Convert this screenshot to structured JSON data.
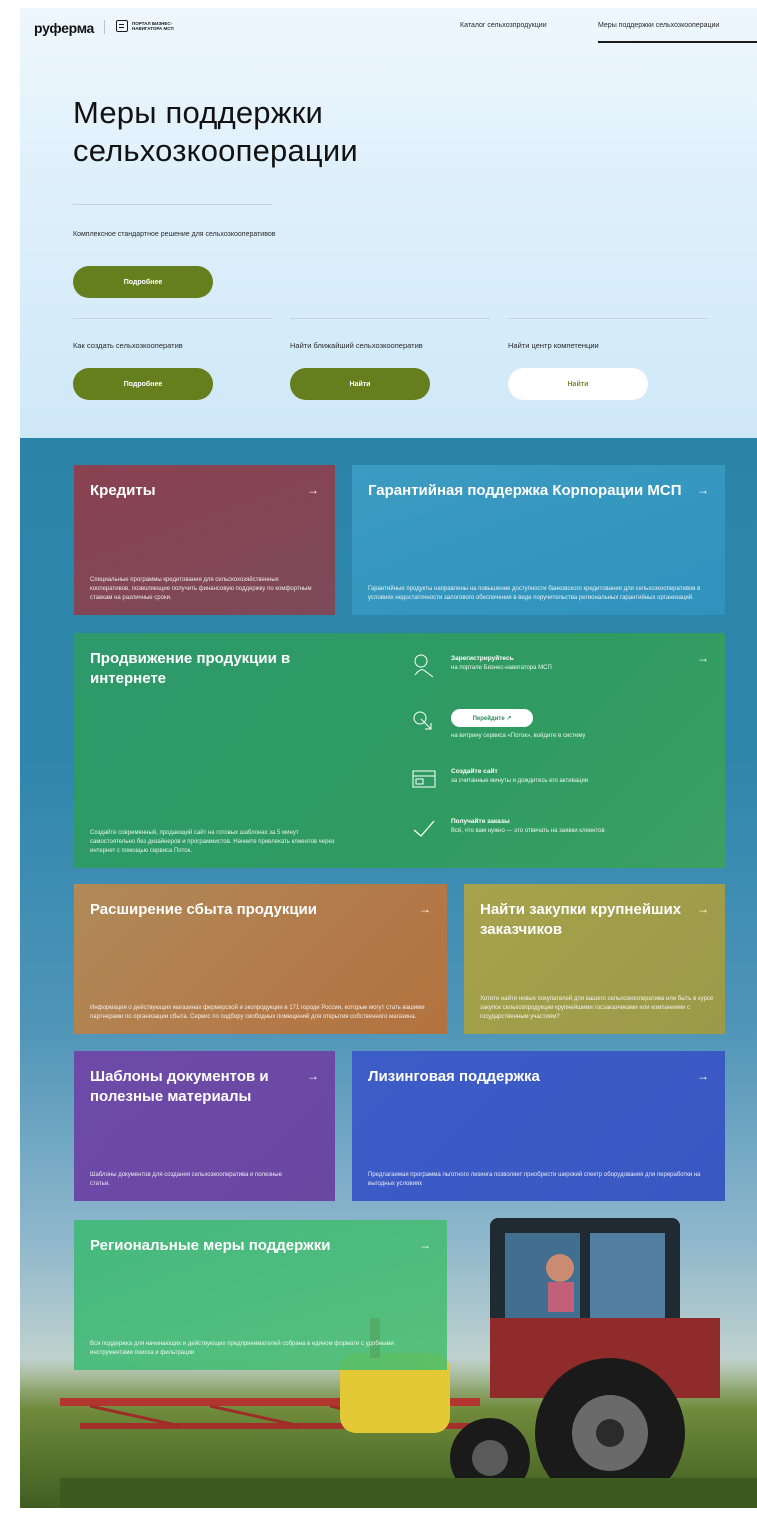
{
  "header": {
    "logo": "руферма",
    "partner": "ПОРТАЛ БИЗНЕС-НАВИГАТОРА МСП",
    "nav": [
      "Каталог сельхозпродукции",
      "Меры поддержки сельхозкооперации"
    ]
  },
  "hero": {
    "title": "Меры поддержки сельхозкооперации",
    "description": "Комплексное стандартное решение для сельхозкооперативов",
    "more_label": "Подробнее",
    "columns": [
      {
        "title": "Как создать сельхозкооператив",
        "button": "Подробнее"
      },
      {
        "title": "Найти ближайший сельхозкооператив",
        "button": "Найти"
      },
      {
        "title": "Найти центр компетенции",
        "button": "Найти"
      }
    ]
  },
  "cards": {
    "credits": {
      "title": "Кредиты",
      "desc": "Специальные программы кредитования для сельскохозяйственных кооперативов, позволяющие получить финансовую поддержку по комфортным ставкам на различные сроки."
    },
    "guarantee": {
      "title": "Гарантийная поддержка Корпорации МСП",
      "desc": "Гарантийные продукты направлены на повышение доступности банковского кредитования для сельхозкооперативов в условиях недостаточности залогового обеспечения в виде поручительства региональных гарантийных организаций."
    },
    "promo": {
      "title": "Продвижение продукции в интернете",
      "desc": "Создайте современный, продающий сайт на готовых шаблонах за 5 минут самостоятельно без дизайнеров и программистов. Начните привлекать клиентов через интернет с помощью сервиса Поток.",
      "steps": [
        {
          "head": "Зарегистрируйтесь",
          "sub": "на портале Бизнес-навигатора МСП"
        },
        {
          "button": "Перейдите ↗",
          "sub": "на витрину сервиса «Поток», войдите в систему"
        },
        {
          "head": "Создайте сайт",
          "sub": "за считанные минуты и дождитесь его активации"
        },
        {
          "head": "Получайте заказы",
          "sub": "Всё, что вам нужно — это отвечать на заявки клиентов"
        }
      ]
    },
    "sales": {
      "title": "Расширение сбыта продукции",
      "desc": "Информация о действующих магазинах фермерской и экопродукции в 171 городе России, которые могут стать вашими партнерами по организации сбыта. Сервис по подбору свободных помещений для открытия собственного магазина."
    },
    "tenders": {
      "title": "Найти закупки крупнейших заказчиков",
      "desc": "Хотите найти новых покупателей для вашего сельхозкооператива или быть в курсе закупок сельхозпродукции крупнейшими госзаказчиками или компаниями с государственным участием?"
    },
    "templates": {
      "title": "Шаблоны документов и полезные материалы",
      "desc": "Шаблоны документов для создания сельхозкооператива и полезные статьи."
    },
    "leasing": {
      "title": "Лизинговая поддержка",
      "desc": "Предлагаемая программа льготного лизинга позволяет приобрести широкий спектр оборудования для переработки на выгодных условиях"
    },
    "regional": {
      "title": "Региональные меры поддержки",
      "desc": "Вся поддержка для начинающих и действующих предпринимателей собрана в едином формате с удобными инструментами поиска и фильтрации"
    }
  },
  "arrow": "→",
  "colors": {
    "accent_green": "#667f1e",
    "credits": "#8a4150",
    "guarantee": "#3c9bc1",
    "promo": "#2e9a6c",
    "sales": "#b37a49",
    "tenders": "#a7a24d",
    "templates": "#6d4aa8",
    "leasing": "#3c5cc7",
    "regional": "#40b978"
  }
}
